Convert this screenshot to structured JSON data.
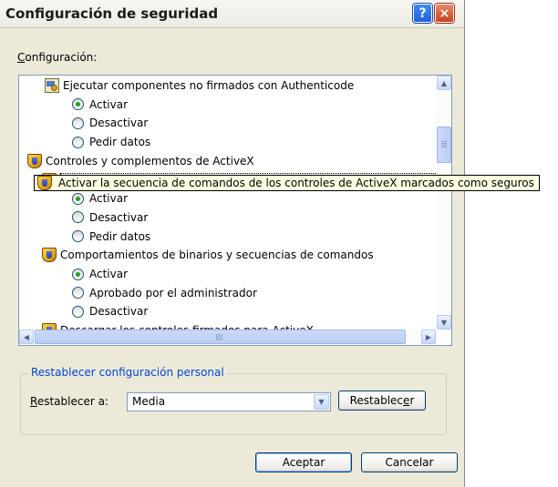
{
  "dialog": {
    "title": "Configuración de seguridad",
    "help_glyph": "?",
    "close_glyph": "×"
  },
  "settings": {
    "label_prefix": "C",
    "label_rest": "onfiguración:"
  },
  "tree": {
    "rows": [
      {
        "type": "setting",
        "icon": "certificate-icon",
        "text": "Ejecutar componentes no firmados con Authenticode"
      },
      {
        "type": "radio",
        "checked": true,
        "text": "Activar"
      },
      {
        "type": "radio",
        "checked": false,
        "text": "Desactivar"
      },
      {
        "type": "radio",
        "checked": false,
        "text": "Pedir datos"
      },
      {
        "type": "category",
        "icon": "shield-icon",
        "text": "Controles y complementos de ActiveX"
      },
      {
        "type": "setting",
        "icon": "shield-icon",
        "text": "Activar la secuencia de comandos de los controles de ActiveX marcados como seguros",
        "selected": true
      },
      {
        "type": "radio",
        "checked": true,
        "text": "Activar"
      },
      {
        "type": "radio",
        "checked": false,
        "text": "Desactivar"
      },
      {
        "type": "radio",
        "checked": false,
        "text": "Pedir datos"
      },
      {
        "type": "setting",
        "icon": "shield-icon",
        "text": "Comportamientos de binarios y secuencias de comandos"
      },
      {
        "type": "radio",
        "checked": true,
        "text": "Activar"
      },
      {
        "type": "radio",
        "checked": false,
        "text": "Aprobado por el administrador"
      },
      {
        "type": "radio",
        "checked": false,
        "text": "Desactivar"
      },
      {
        "type": "setting",
        "icon": "shield-icon",
        "text": "Descargar los controles firmados para ActiveX"
      }
    ]
  },
  "tooltip": {
    "text": "Activar la secuencia de comandos de los controles de ActiveX marcados como seguros"
  },
  "scrollbars": {
    "up": "▲",
    "down": "▼",
    "left": "◀",
    "right": "▶"
  },
  "reset": {
    "group_title": "Restablecer configuración personal",
    "label_prefix": "R",
    "label_rest": "establecer a:",
    "level_value": "Media",
    "dropdown_glyph": "▼",
    "button_prefix": "Restablec",
    "button_mnemonic": "e",
    "button_suffix": "r"
  },
  "footer": {
    "ok_label": "Aceptar",
    "cancel_label": "Cancelar"
  },
  "colors": {
    "accent": "#0046d5",
    "radio_checked": "#21a121"
  }
}
